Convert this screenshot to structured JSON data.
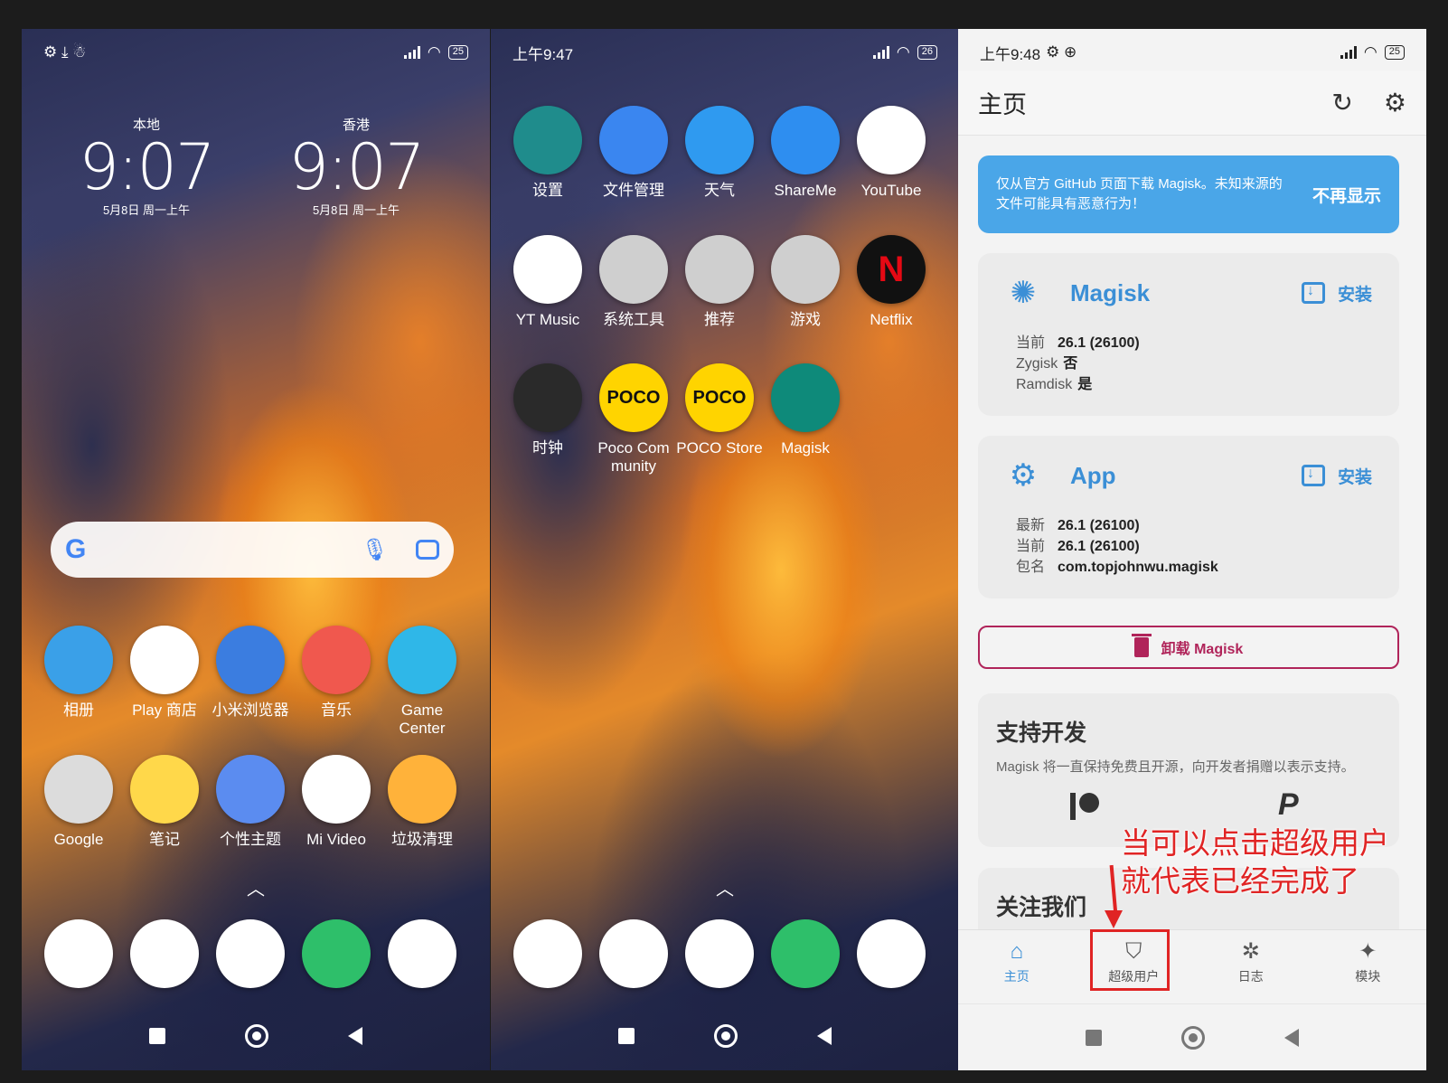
{
  "phone1": {
    "status_battery": "25",
    "clocks": [
      {
        "city": "本地",
        "time": "9:07",
        "date": "5月8日 周一上午"
      },
      {
        "city": "香港",
        "time": "9:07",
        "date": "5月8日 周一上午"
      }
    ],
    "search_logo": "G",
    "apps_row1": [
      {
        "label": "相册",
        "icon": "gallery-icon",
        "color": "#3aa0e8"
      },
      {
        "label": "Play 商店",
        "icon": "play-store-icon",
        "color": "#ffffff"
      },
      {
        "label": "小米浏览器",
        "icon": "browser-icon",
        "color": "#3b7de0"
      },
      {
        "label": "音乐",
        "icon": "music-icon",
        "color": "#f0584e"
      },
      {
        "label": "Game Center",
        "icon": "game-center-icon",
        "color": "#2fb7e8"
      }
    ],
    "apps_row2": [
      {
        "label": "Google",
        "icon": "google-folder-icon",
        "color": "#dcdcdc"
      },
      {
        "label": "笔记",
        "icon": "notes-icon",
        "color": "#ffd84a"
      },
      {
        "label": "个性主题",
        "icon": "themes-icon",
        "color": "#5b8cf0"
      },
      {
        "label": "Mi Video",
        "icon": "mi-video-icon",
        "color": "#ffffff"
      },
      {
        "label": "垃圾清理",
        "icon": "cleaner-icon",
        "color": "#ffb23a"
      }
    ],
    "dock": [
      {
        "icon": "phone-icon",
        "color": "#ffffff"
      },
      {
        "icon": "messages-icon",
        "color": "#ffffff"
      },
      {
        "icon": "chrome-icon",
        "color": "#ffffff"
      },
      {
        "icon": "security-icon",
        "color": "#2ebf6a"
      },
      {
        "icon": "camera-icon",
        "color": "#ffffff"
      }
    ]
  },
  "phone2": {
    "status_time": "上午9:47",
    "status_battery": "26",
    "apps_row1": [
      {
        "label": "设置",
        "icon": "settings-icon",
        "color": "#1f8c8c"
      },
      {
        "label": "文件管理",
        "icon": "file-manager-icon",
        "color": "#3a86f0"
      },
      {
        "label": "天气",
        "icon": "weather-icon",
        "color": "#2f9af0"
      },
      {
        "label": "ShareMe",
        "icon": "shareme-icon",
        "color": "#2e8ef0"
      },
      {
        "label": "YouTube",
        "icon": "youtube-icon",
        "color": "#ffffff"
      }
    ],
    "apps_row2": [
      {
        "label": "YT Music",
        "icon": "yt-music-icon",
        "color": "#ffffff"
      },
      {
        "label": "系统工具",
        "icon": "system-tools-folder-icon",
        "color": "#cfcfcf"
      },
      {
        "label": "推荐",
        "icon": "recommend-folder-icon",
        "color": "#cfcfcf"
      },
      {
        "label": "游戏",
        "icon": "games-folder-icon",
        "color": "#cfcfcf"
      },
      {
        "label": "Netflix",
        "icon": "netflix-icon",
        "color": "#111111"
      }
    ],
    "apps_row3": [
      {
        "label": "时钟",
        "icon": "clock-icon",
        "color": "#2a2a2a"
      },
      {
        "label": "Poco Com munity",
        "icon": "poco-community-icon",
        "color": "#ffd400"
      },
      {
        "label": "POCO Store",
        "icon": "poco-store-icon",
        "color": "#ffd400"
      },
      {
        "label": "Magisk",
        "icon": "magisk-icon",
        "color": "#0e8a7a"
      }
    ],
    "poco_text": "POCO",
    "netflix_text": "N"
  },
  "phone3": {
    "status_time": "上午9:48",
    "status_battery": "25",
    "title": "主页",
    "notice": {
      "message": "仅从官方 GitHub 页面下载 Magisk。未知来源的文件可能具有恶意行为！",
      "dismiss": "不再显示"
    },
    "magisk_card": {
      "name": "Magisk",
      "install": "安装",
      "rows": [
        {
          "k": "当前",
          "v": "26.1 (26100)"
        },
        {
          "k": "Zygisk",
          "v": "否"
        },
        {
          "k": "Ramdisk",
          "v": "是"
        }
      ]
    },
    "app_card": {
      "name": "App",
      "install": "安装",
      "rows": [
        {
          "k": "最新",
          "v": "26.1 (26100)"
        },
        {
          "k": "当前",
          "v": "26.1 (26100)"
        },
        {
          "k": "包名",
          "v": "com.topjohnwu.magisk"
        }
      ]
    },
    "uninstall": "卸载 Magisk",
    "support": {
      "title": "支持开发",
      "desc": "Magisk 将一直保持免费且开源，向开发者捐赠以表示支持。"
    },
    "follow_title": "关注我们",
    "bottom_nav": [
      {
        "label": "主页",
        "icon": "home-icon"
      },
      {
        "label": "超级用户",
        "icon": "shield-icon"
      },
      {
        "label": "日志",
        "icon": "bug-icon"
      },
      {
        "label": "模块",
        "icon": "puzzle-icon"
      }
    ],
    "annotation": [
      "当可以点击超级用户",
      "就代表已经完成了"
    ]
  }
}
